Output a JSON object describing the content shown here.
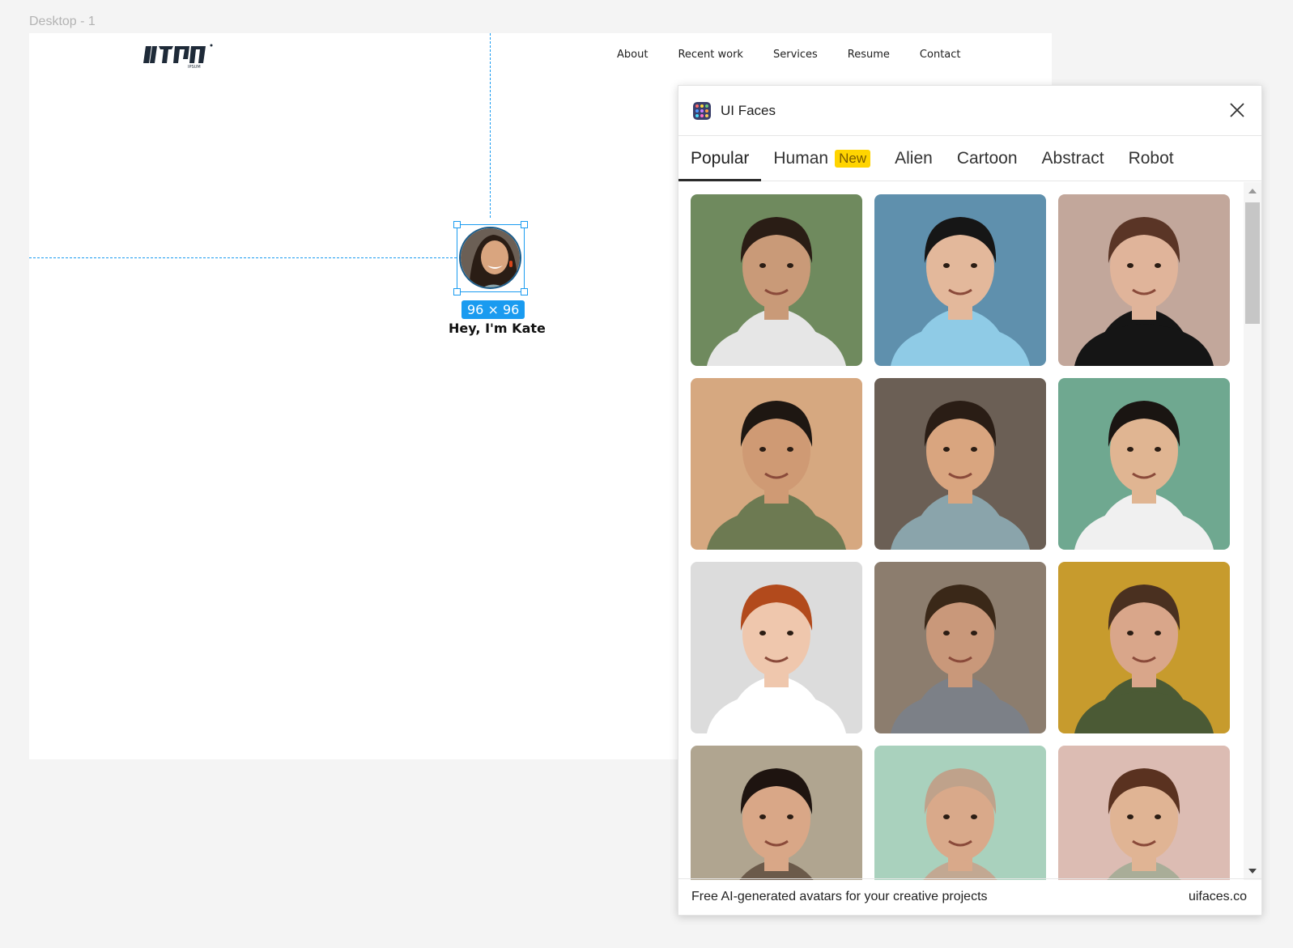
{
  "canvas": {
    "frame_label": "Desktop - 1",
    "logo_alt": "logo ipsum"
  },
  "nav": {
    "items": [
      "About",
      "Recent work",
      "Services",
      "Resume",
      "Contact"
    ]
  },
  "selection": {
    "size_label": "96 × 96",
    "caption": "Hey, I'm Kate"
  },
  "plugin": {
    "title": "UI Faces",
    "tabs": [
      {
        "label": "Popular",
        "active": true
      },
      {
        "label": "Human",
        "badge": "New"
      },
      {
        "label": "Alien"
      },
      {
        "label": "Cartoon"
      },
      {
        "label": "Abstract"
      },
      {
        "label": "Robot"
      }
    ],
    "avatars": [
      {
        "name": "avatar-man-beard-tshirt",
        "bg": "#6f8a5e",
        "skin": "#c99a78",
        "hair": "#2a1d15",
        "shirt": "#e6e6e6"
      },
      {
        "name": "avatar-woman-blue-shirt",
        "bg": "#5f90ad",
        "skin": "#e3b89b",
        "hair": "#161616",
        "shirt": "#8fcbe6"
      },
      {
        "name": "avatar-man-black-hoodie",
        "bg": "#c2a79b",
        "skin": "#e0b49a",
        "hair": "#5a3526",
        "shirt": "#151515"
      },
      {
        "name": "avatar-man-olive-tee",
        "bg": "#d6a880",
        "skin": "#cf9a74",
        "hair": "#1e1712",
        "shirt": "#6d7a52"
      },
      {
        "name": "avatar-woman-laughing",
        "bg": "#6b5f55",
        "skin": "#d9a57f",
        "hair": "#2a1d15",
        "shirt": "#8aa4ab"
      },
      {
        "name": "avatar-man-glasses-striped",
        "bg": "#6fa890",
        "skin": "#e0b592",
        "hair": "#1a1512",
        "shirt": "#f0f0f0"
      },
      {
        "name": "avatar-woman-red-hair",
        "bg": "#dcdcdc",
        "skin": "#efc7ad",
        "hair": "#b24a1c",
        "shirt": "#ffffff"
      },
      {
        "name": "avatar-man-grey-tee",
        "bg": "#8c7d6e",
        "skin": "#c9987a",
        "hair": "#3a2818",
        "shirt": "#7c8087"
      },
      {
        "name": "avatar-man-green-jacket",
        "bg": "#c79b2d",
        "skin": "#d9a68a",
        "hair": "#4a3020",
        "shirt": "#4b5a35"
      },
      {
        "name": "avatar-woman-dark-curly",
        "bg": "#b0a590",
        "skin": "#d9a787",
        "hair": "#1e1410",
        "shirt": "#6b5a4a"
      },
      {
        "name": "avatar-woman-hijab",
        "bg": "#a9d1bd",
        "skin": "#d9a98a",
        "hair": "#bfa28b",
        "shirt": "#c2a892"
      },
      {
        "name": "avatar-woman-hoodie",
        "bg": "#dcbcb3",
        "skin": "#e0b494",
        "hair": "#5a3220",
        "shirt": "#a9ad98"
      }
    ],
    "footer_text": "Free AI-generated avatars for your creative projects",
    "footer_link": "uifaces.co"
  },
  "colors": {
    "selection_blue": "#1a9bf0",
    "new_badge": "#ffd400"
  }
}
